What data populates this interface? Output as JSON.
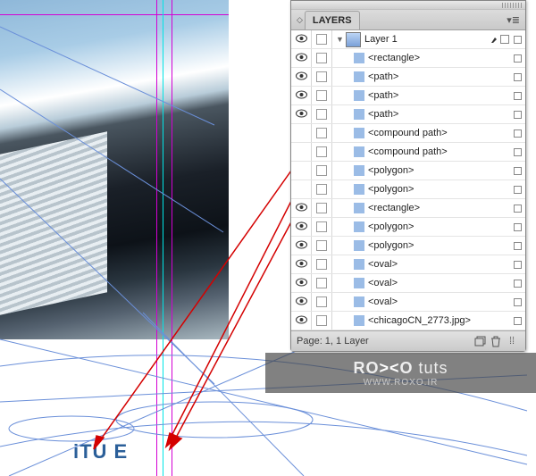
{
  "panel": {
    "title": "LAYERS",
    "footer": "Page: 1, 1 Layer",
    "parent_layer": "Layer 1",
    "items": [
      {
        "name": "<rectangle>",
        "vis": true
      },
      {
        "name": "<path>",
        "vis": true
      },
      {
        "name": "<path>",
        "vis": true
      },
      {
        "name": "<path>",
        "vis": true
      },
      {
        "name": "<compound path>",
        "vis": false
      },
      {
        "name": "<compound path>",
        "vis": false
      },
      {
        "name": "<polygon>",
        "vis": false
      },
      {
        "name": "<polygon>",
        "vis": false
      },
      {
        "name": "<rectangle>",
        "vis": true
      },
      {
        "name": "<polygon>",
        "vis": true
      },
      {
        "name": "<polygon>",
        "vis": true
      },
      {
        "name": "<oval>",
        "vis": true
      },
      {
        "name": "<oval>",
        "vis": true
      },
      {
        "name": "<oval>",
        "vis": true
      },
      {
        "name": "<chicagoCN_2773.jpg>",
        "vis": true
      }
    ]
  },
  "canvas_text": "iTU   E",
  "watermark": {
    "line1_a": "RO",
    "line1_b": "><",
    "line1_c": "O",
    "line1_d": " tuts",
    "line2": "WWW.ROXO.IR"
  }
}
